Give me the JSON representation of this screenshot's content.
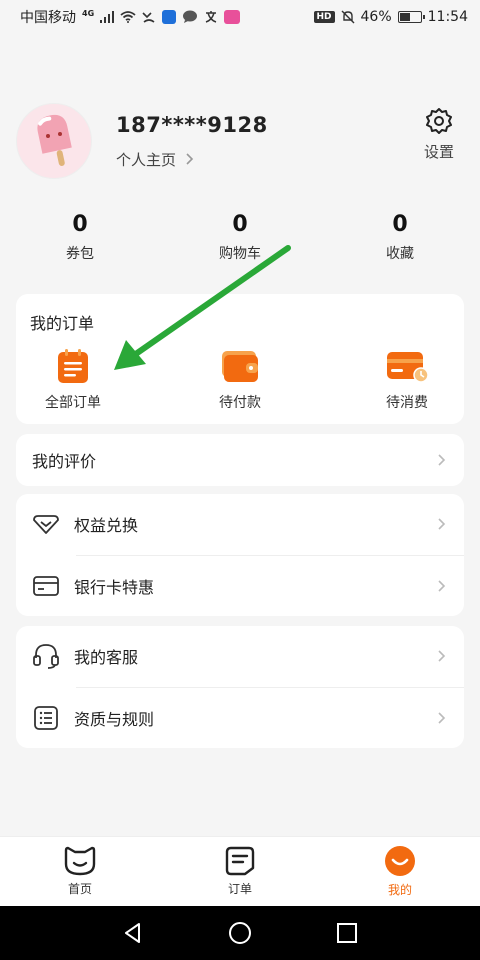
{
  "status_bar": {
    "carrier": "中国移动",
    "network": "4G",
    "battery": "46%",
    "time": "11:54",
    "hd": "HD"
  },
  "profile": {
    "phone": "187****9128",
    "home_link": "个人主页",
    "settings_label": "设置"
  },
  "stats": [
    {
      "value": "0",
      "label": "券包"
    },
    {
      "value": "0",
      "label": "购物车"
    },
    {
      "value": "0",
      "label": "收藏"
    }
  ],
  "orders": {
    "title": "我的订单",
    "items": [
      {
        "label": "全部订单",
        "icon": "clipboard-icon"
      },
      {
        "label": "待付款",
        "icon": "wallet-icon"
      },
      {
        "label": "待消费",
        "icon": "card-clock-icon"
      }
    ]
  },
  "menu": {
    "review": "我的评价",
    "rights": "权益兑换",
    "bank_card": "银行卡特惠",
    "service": "我的客服",
    "rules": "资质与规则"
  },
  "tabbar": {
    "home": "首页",
    "orders": "订单",
    "mine": "我的",
    "accent": "#f26a10"
  },
  "colors": {
    "accent": "#f26a10",
    "arrow": "#2aa838"
  }
}
